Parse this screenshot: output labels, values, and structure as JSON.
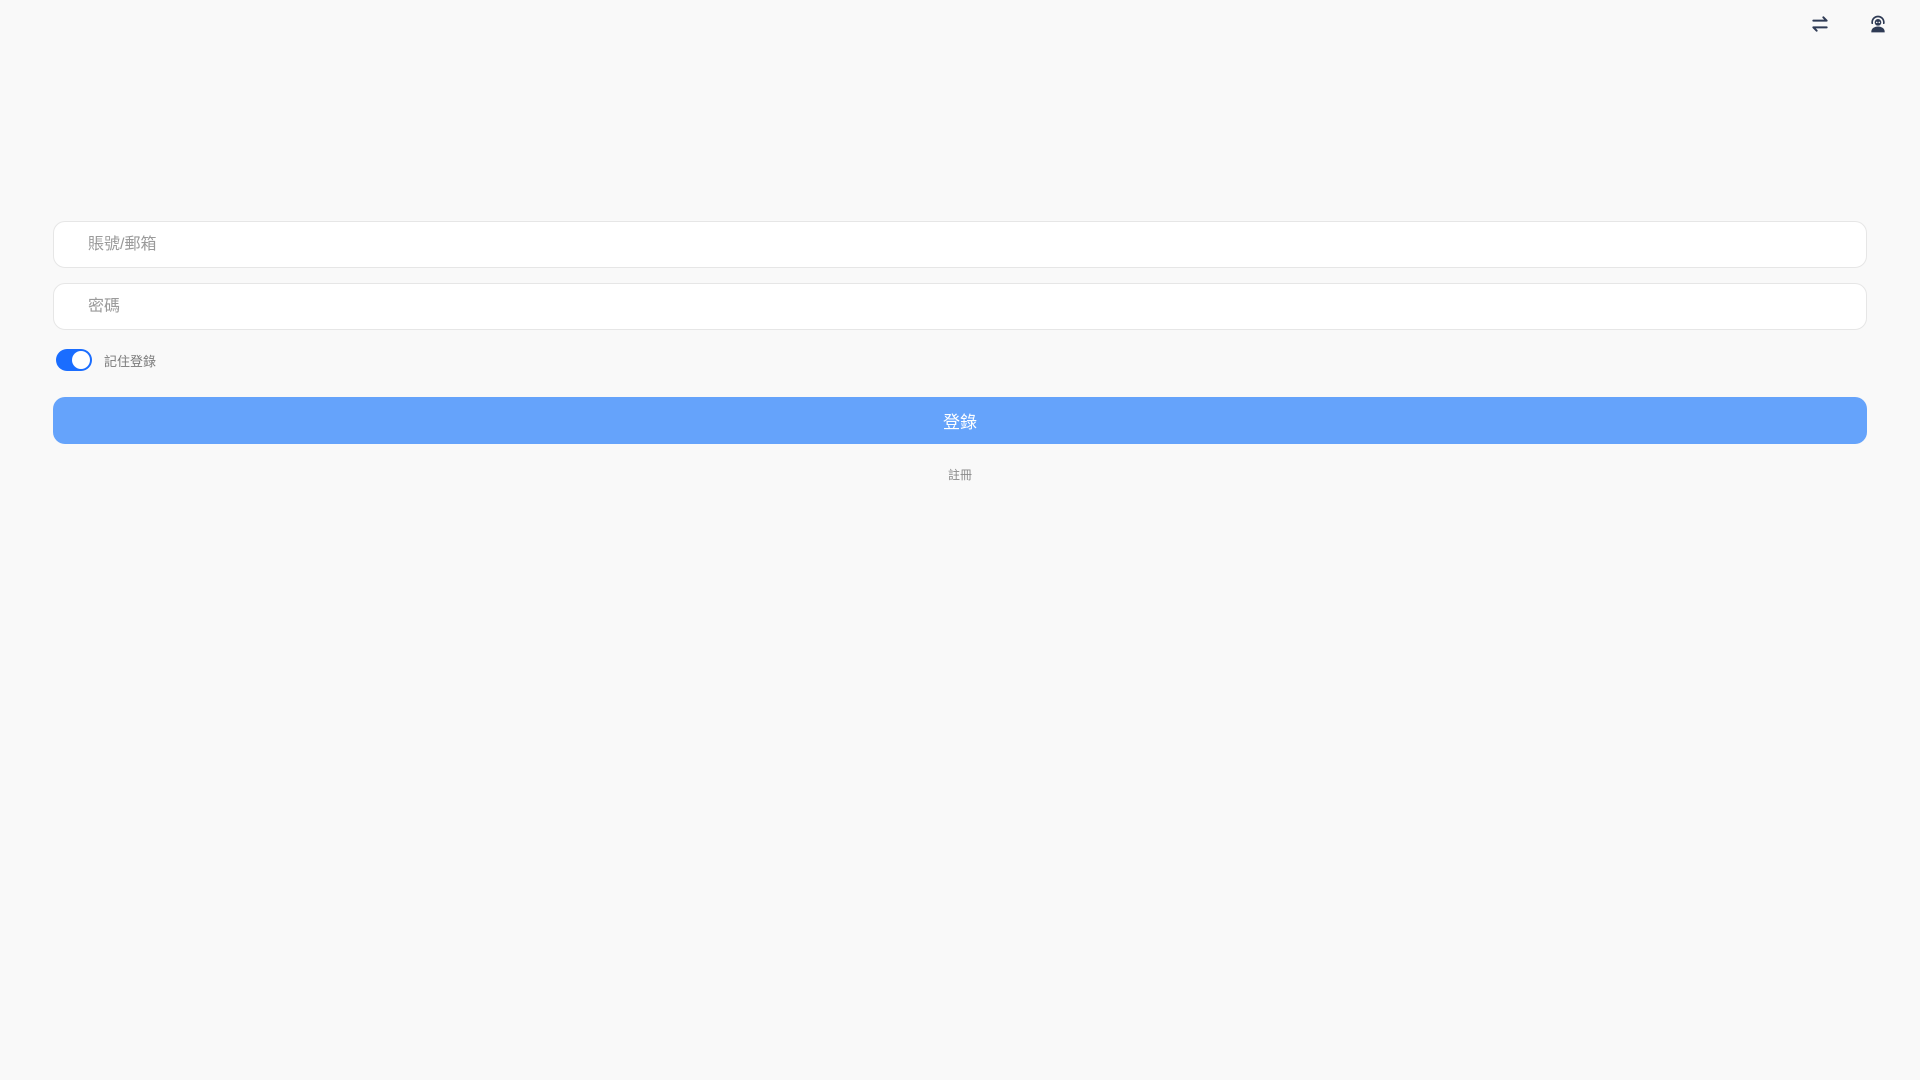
{
  "header": {
    "icons": [
      "swap-arrows-icon",
      "support-agent-icon"
    ]
  },
  "form": {
    "account": {
      "placeholder": "賬號/郵箱",
      "value": ""
    },
    "password": {
      "placeholder": "密碼",
      "value": ""
    },
    "remember": {
      "label": "記住登錄",
      "checked": true
    },
    "login_label": "登錄",
    "register_label": "註冊"
  },
  "colors": {
    "background": "#f9f9f9",
    "toggle_on": "#1a6dff",
    "login_button": "#65a3fb",
    "icon": "#2f3b55"
  }
}
